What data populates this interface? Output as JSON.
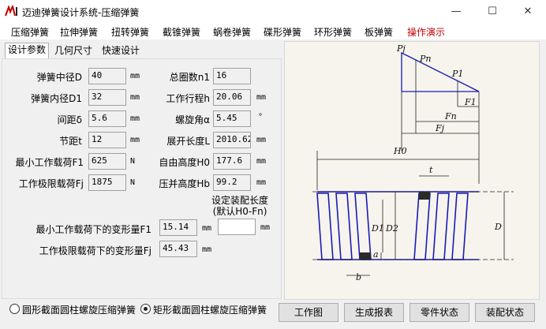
{
  "window": {
    "title": "迈迪弹簧设计系统-压缩弹簧",
    "min_glyph": "—",
    "max_glyph": "☐",
    "close_glyph": "✕"
  },
  "menu": {
    "items": [
      "压缩弹簧",
      "拉伸弹簧",
      "扭转弹簧",
      "截锥弹簧",
      "蜗卷弹簧",
      "碟形弹簧",
      "环形弹簧",
      "板弹簧",
      "操作演示"
    ],
    "active_color": "#c00000"
  },
  "tabs": [
    "设计参数",
    "几何尺寸",
    "快速设计"
  ],
  "params": {
    "D": {
      "label": "弹簧中径D",
      "value": "40",
      "unit": "mm"
    },
    "D1": {
      "label": "弹簧内径D1",
      "value": "32",
      "unit": "mm"
    },
    "delta": {
      "label": "间距δ",
      "value": "5.6",
      "unit": "mm"
    },
    "t": {
      "label": "节距t",
      "value": "12",
      "unit": "mm"
    },
    "F1": {
      "label": "最小工作载荷F1",
      "value": "625",
      "unit": "N"
    },
    "Fj": {
      "label": "工作极限载荷Fj",
      "value": "1875",
      "unit": "N"
    },
    "n1": {
      "label": "总圈数n1",
      "value": "16",
      "unit": ""
    },
    "h": {
      "label": "工作行程h",
      "value": "20.06",
      "unit": "mm"
    },
    "alpha": {
      "label": "螺旋角α",
      "value": "5.45",
      "unit": "°"
    },
    "L": {
      "label": "展开长度L",
      "value": "2010.62",
      "unit": "mm"
    },
    "H0": {
      "label": "自由高度H0",
      "value": "177.6",
      "unit": "mm"
    },
    "Hb": {
      "label": "压并高度Hb",
      "value": "99.2",
      "unit": "mm"
    },
    "def1": {
      "label": "最小工作载荷下的变形量F1",
      "value": "15.14",
      "unit": "mm"
    },
    "defj": {
      "label": "工作极限载荷下的变形量Fj",
      "value": "45.43",
      "unit": "mm"
    },
    "assembly": {
      "label_line1": "设定装配长度",
      "label_line2": "(默认H0-Fn)",
      "value": "",
      "unit": "mm"
    }
  },
  "diagram": {
    "labels": {
      "Pj": "Pj",
      "Pn": "Pn",
      "P1": "P1",
      "F1": "F1",
      "Fn": "Fn",
      "Fj": "Fj",
      "H0": "H0",
      "t": "t",
      "D1": "D1",
      "D2": "D2",
      "D": "D",
      "a": "a",
      "b": "b"
    },
    "line_color": "#1a1ab8"
  },
  "bottom": {
    "radio1": "圆形截面圆柱螺旋压缩弹簧",
    "radio2": "矩形截面圆柱螺旋压缩弹簧",
    "selected": "radio2",
    "buttons": [
      "工作图",
      "生成报表",
      "零件状态",
      "装配状态"
    ]
  }
}
